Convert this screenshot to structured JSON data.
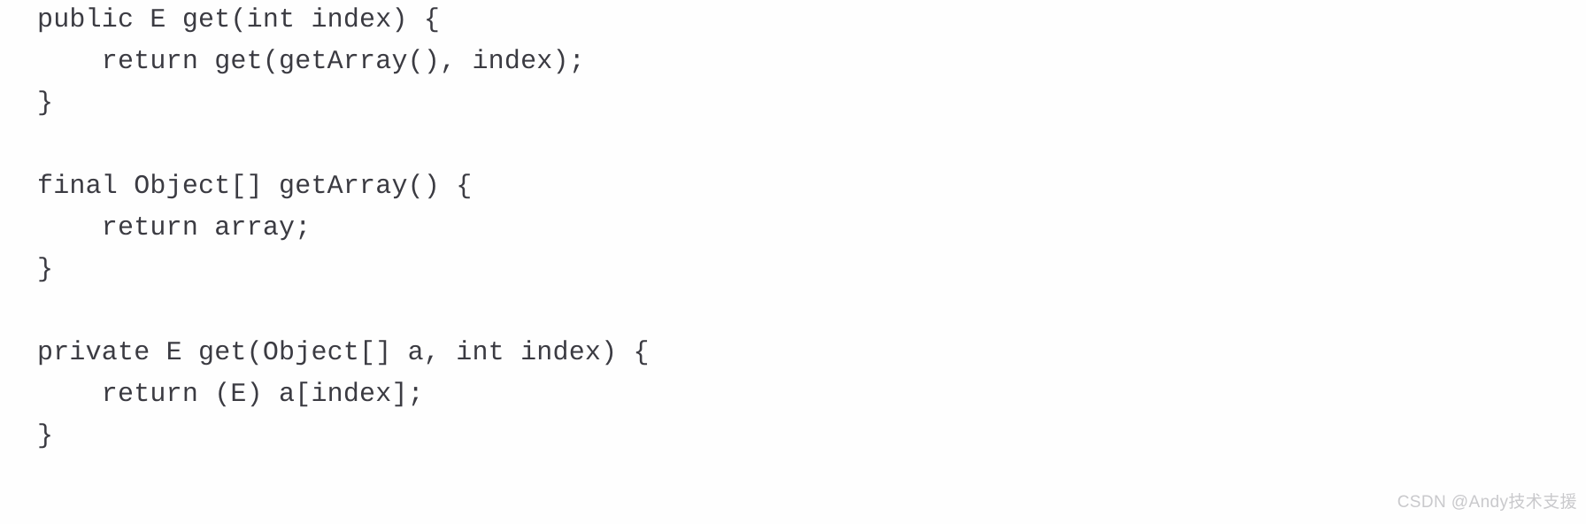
{
  "document": {
    "type": "code-snippet",
    "language": "java",
    "background_color": "#fefefe",
    "text_color": "#3b3b42"
  },
  "code": {
    "lines": [
      "public E get(int index) {",
      "    return get(getArray(), index);",
      "}",
      "",
      "final Object[] getArray() {",
      "    return array;",
      "}",
      "",
      "private E get(Object[] a, int index) {",
      "    return (E) a[index];",
      "}"
    ]
  },
  "watermark": {
    "text": "CSDN @Andy技术支援",
    "color": "#c9c9cc"
  }
}
